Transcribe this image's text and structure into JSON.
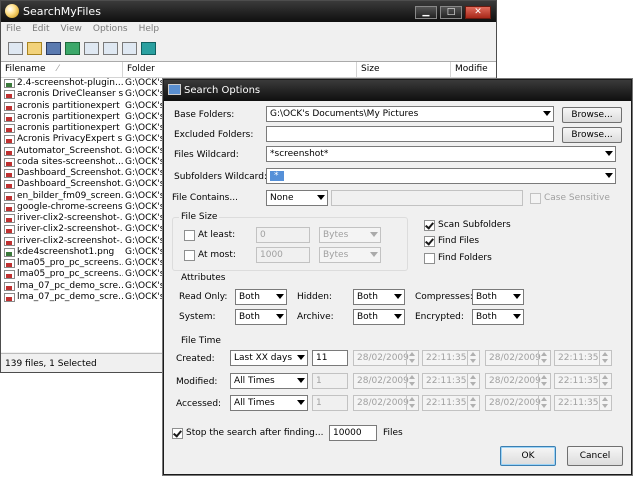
{
  "main_window": {
    "title": "SearchMyFiles",
    "menu": [
      "File",
      "Edit",
      "View",
      "Options",
      "Help"
    ],
    "toolbar": [
      "properties-icon",
      "open-icon",
      "save-icon",
      "refresh-icon",
      "copy-icon",
      "clipboard-icon",
      "search-icon",
      "exit-icon"
    ],
    "columns": [
      "Filename",
      "Folder",
      "Size",
      "Modifie"
    ],
    "rows": [
      {
        "name": "2.4-screenshot-plugin....",
        "folder": "G:\\OCK's",
        "type": "png"
      },
      {
        "name": "acronis DriveCleanser s...",
        "folder": "G:\\OCK's",
        "type": "jpg"
      },
      {
        "name": "acronis partitionexpert ...",
        "folder": "G:\\OCK's",
        "type": "jpg"
      },
      {
        "name": "acronis partitionexpert s...",
        "folder": "G:\\OCK's",
        "type": "jpg"
      },
      {
        "name": "acronis partitionexpert ...",
        "folder": "G:\\OCK's",
        "type": "jpg"
      },
      {
        "name": "Acronis PrivacyExpert s...",
        "folder": "G:\\OCK's",
        "type": "jpg"
      },
      {
        "name": "Automator_Screenshot...",
        "folder": "G:\\OCK's",
        "type": "jpg"
      },
      {
        "name": "coda sites-screenshot....",
        "folder": "G:\\OCK's",
        "type": "jpg"
      },
      {
        "name": "Dashboard_Screenshot...",
        "folder": "G:\\OCK's",
        "type": "jpg"
      },
      {
        "name": "Dashboard_Screenshot...",
        "folder": "G:\\OCK's",
        "type": "jpg"
      },
      {
        "name": "en_bilder_fm09_screen...",
        "folder": "G:\\OCK's",
        "type": "jpg"
      },
      {
        "name": "google-chrome-screens...",
        "folder": "G:\\OCK's",
        "type": "jpg"
      },
      {
        "name": "iriver-clix2-screenshot-...",
        "folder": "G:\\OCK's",
        "type": "jpg"
      },
      {
        "name": "iriver-clix2-screenshot-...",
        "folder": "G:\\OCK's",
        "type": "jpg"
      },
      {
        "name": "iriver-clix2-screenshot-...",
        "folder": "G:\\OCK's",
        "type": "jpg"
      },
      {
        "name": "kde4screenshot1.png",
        "folder": "G:\\OCK's",
        "type": "png"
      },
      {
        "name": "lma05_pro_pc_screens...",
        "folder": "G:\\OCK's",
        "type": "jpg"
      },
      {
        "name": "lma05_pro_pc_screens...",
        "folder": "G:\\OCK's",
        "type": "jpg"
      },
      {
        "name": "lma_07_pc_demo_scre...",
        "folder": "G:\\OCK's",
        "type": "jpg"
      },
      {
        "name": "lma_07_pc_demo_scre...",
        "folder": "G:\\OCK's",
        "type": "jpg"
      }
    ],
    "status": "139 files, 1 Selected",
    "scroll_grip": "|||"
  },
  "dialog": {
    "title": "Search Options",
    "base_folders_label": "Base Folders:",
    "base_folders_value": "G:\\OCK's Documents\\My Pictures",
    "browse_label": "Browse...",
    "excluded_folders_label": "Excluded Folders:",
    "excluded_folders_value": "",
    "files_wildcard_label": "Files Wildcard:",
    "files_wildcard_value": "*screenshot*",
    "subfolders_wildcard_label": "Subfolders Wildcard:",
    "subfolders_wildcard_value": "*",
    "file_contains_label": "File Contains...",
    "file_contains_mode": "None",
    "case_sensitive_label": "Case Sensitive",
    "file_size_group": "File Size",
    "at_least_label": "At least:",
    "at_least_value": "0",
    "at_most_label": "At most:",
    "at_most_value": "1000",
    "bytes_label": "Bytes",
    "scan_subfolders_label": "Scan Subfolders",
    "find_files_label": "Find Files",
    "find_folders_label": "Find Folders",
    "attributes_group": "Attributes",
    "read_only_label": "Read Only:",
    "hidden_label": "Hidden:",
    "compresses_label": "Compresses:",
    "system_label": "System:",
    "archive_label": "Archive:",
    "encrypted_label": "Encrypted:",
    "both": "Both",
    "file_time_group": "File Time",
    "created_label": "Created:",
    "created_mode": "Last XX days",
    "created_days": "11",
    "modified_label": "Modified:",
    "accessed_label": "Accessed:",
    "all_times": "All Times",
    "one": "1",
    "date": "28/02/2009",
    "time": "22:11:35",
    "stop_label": "Stop the search after finding...",
    "stop_value": "10000",
    "files_suffix": "Files",
    "ok_label": "OK",
    "cancel_label": "Cancel"
  }
}
